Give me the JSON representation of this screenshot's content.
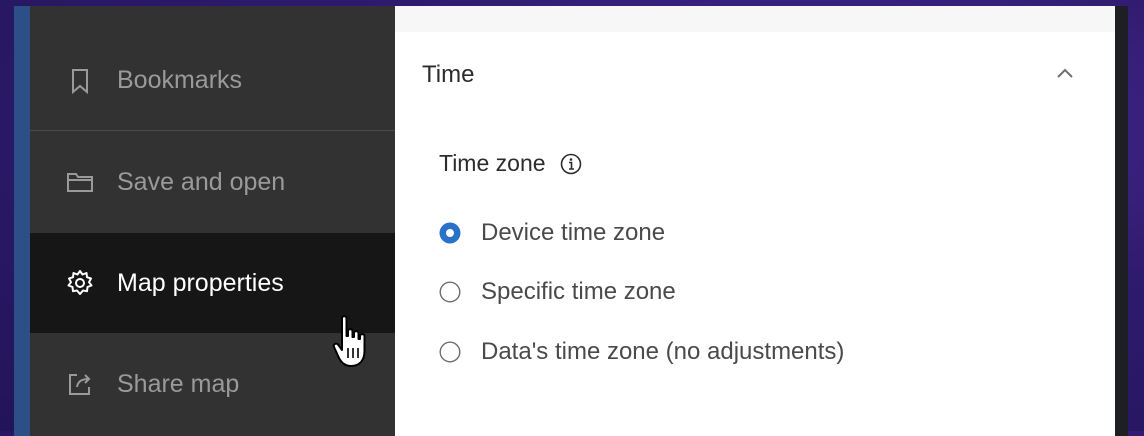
{
  "sidebar": {
    "items": [
      {
        "label": "Bookmarks",
        "icon": "bookmark-icon",
        "active": false
      },
      {
        "label": "Save and open",
        "icon": "folder-icon",
        "active": false
      },
      {
        "label": "Map properties",
        "icon": "gear-icon",
        "active": true
      },
      {
        "label": "Share map",
        "icon": "share-icon",
        "active": false
      }
    ]
  },
  "panel": {
    "title": "Time",
    "collapse_icon": "chevron-up-icon",
    "section_label": "Time zone",
    "info_icon": "info-icon",
    "options": [
      {
        "label": "Device time zone",
        "selected": true
      },
      {
        "label": "Specific time zone",
        "selected": false
      },
      {
        "label": "Data's time zone (no adjustments)",
        "selected": false
      }
    ]
  },
  "colors": {
    "accent": "#2a72c8",
    "sidebar_bg": "#323232",
    "sidebar_active_bg": "#161616",
    "background": "#2f1b6e"
  }
}
